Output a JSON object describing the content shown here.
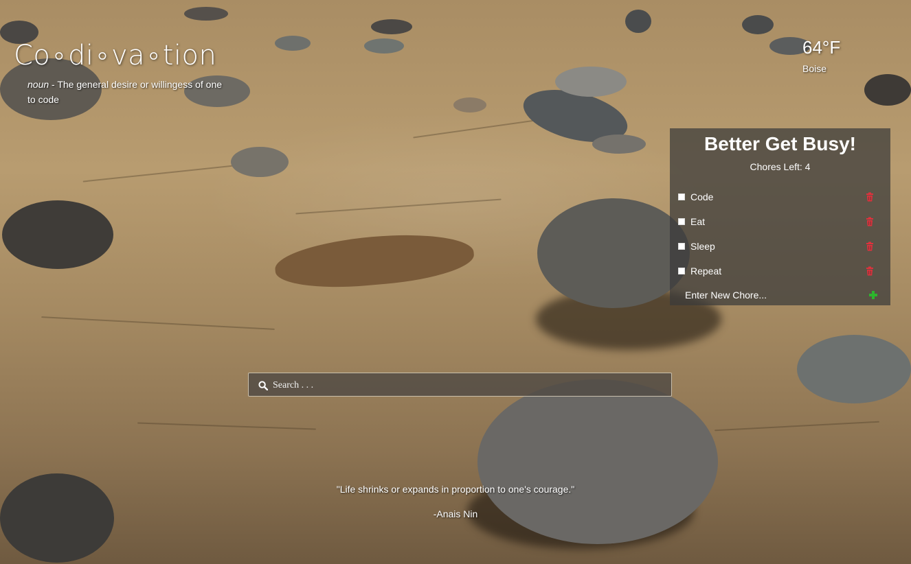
{
  "brand": {
    "title": "Co∘di∘va∘tion",
    "part_of_speech": "noun",
    "definition": " - The general desire or willingess of one to code"
  },
  "weather": {
    "temperature": "64°F",
    "city": "Boise"
  },
  "todo": {
    "title": "Better Get Busy!",
    "count_text": "Chores Left: 4",
    "items": [
      {
        "label": "Code",
        "checked": false
      },
      {
        "label": "Eat",
        "checked": false
      },
      {
        "label": "Sleep",
        "checked": false
      },
      {
        "label": "Repeat",
        "checked": false
      }
    ],
    "new_placeholder": "Enter New Chore...",
    "delete_icon": "trash-icon",
    "add_icon": "plus-icon",
    "delete_color": "#e0313c",
    "add_color": "#2db52d"
  },
  "search": {
    "placeholder": "Search . . .",
    "icon": "search-icon"
  },
  "quote": {
    "text": "\"Life shrinks or expands in proportion to one's courage.\"",
    "author": "-Anais Nin"
  }
}
